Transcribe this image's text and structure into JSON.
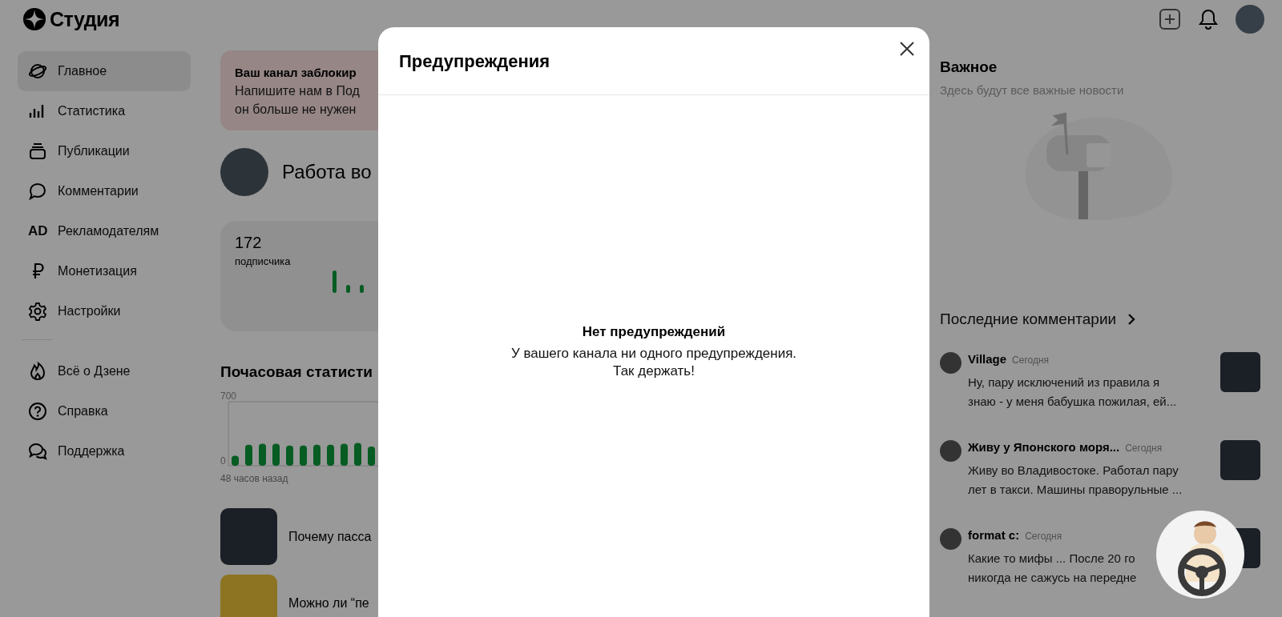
{
  "header": {
    "logo_text": "Студия"
  },
  "sidebar": {
    "items": [
      {
        "label": "Главное",
        "selected": true
      },
      {
        "label": "Статистика",
        "selected": false
      },
      {
        "label": "Публикации",
        "selected": false
      },
      {
        "label": "Комментарии",
        "selected": false
      },
      {
        "label": "Рекламодателям",
        "icon_text": "AD",
        "selected": false
      },
      {
        "label": "Монетизация",
        "selected": false
      },
      {
        "label": "Настройки",
        "selected": false
      }
    ],
    "footer_items": [
      {
        "label": "Всё о Дзене"
      },
      {
        "label": "Справка"
      },
      {
        "label": "Поддержка"
      }
    ]
  },
  "main": {
    "banner": {
      "title": "Ваш канал заблокир",
      "lines": [
        "Напишите нам в Под",
        "он больше не нужен"
      ]
    },
    "channel": {
      "name": "Работа во"
    },
    "subscribers": {
      "count": "172",
      "label": "подписчика"
    },
    "hourly": {
      "title": "Почасовая статисти",
      "caption": "48 часов назад",
      "chart_data": {
        "type": "bar",
        "ylim": [
          0,
          700
        ],
        "yticks": [
          0,
          700
        ],
        "values": [
          110,
          230,
          240,
          240,
          220,
          220,
          230,
          230,
          240,
          250,
          210
        ]
      }
    },
    "articles": [
      {
        "title": "Почему пасса"
      },
      {
        "title": "Можно ли “пе"
      }
    ]
  },
  "right": {
    "important": {
      "title": "Важное",
      "subtitle": "Здесь будут все важные новости"
    },
    "comments": {
      "title": "Последние комментарии",
      "items": [
        {
          "author": "Village",
          "time": "Сегодня",
          "lines": [
            "Ну, пару исключений из правила я",
            "знаю - у меня бабушка пожилая, ей..."
          ]
        },
        {
          "author": "Живу у Японского моря...",
          "time": "Сегодня",
          "lines": [
            "Живу во Владивостоке. Работал пару",
            "лет в такси. Машины праворульные ..."
          ]
        },
        {
          "author": "format c:",
          "time": "Сегодня",
          "lines": [
            "Какие то мифы ... После 20 го",
            "никогда не сажусь на передне"
          ]
        }
      ]
    }
  },
  "modal": {
    "title": "Предупреждения",
    "empty_title": "Нет предупреждений",
    "empty_lines": [
      "У вашего канала ни одного предупреждения.",
      "Так держать!"
    ]
  }
}
